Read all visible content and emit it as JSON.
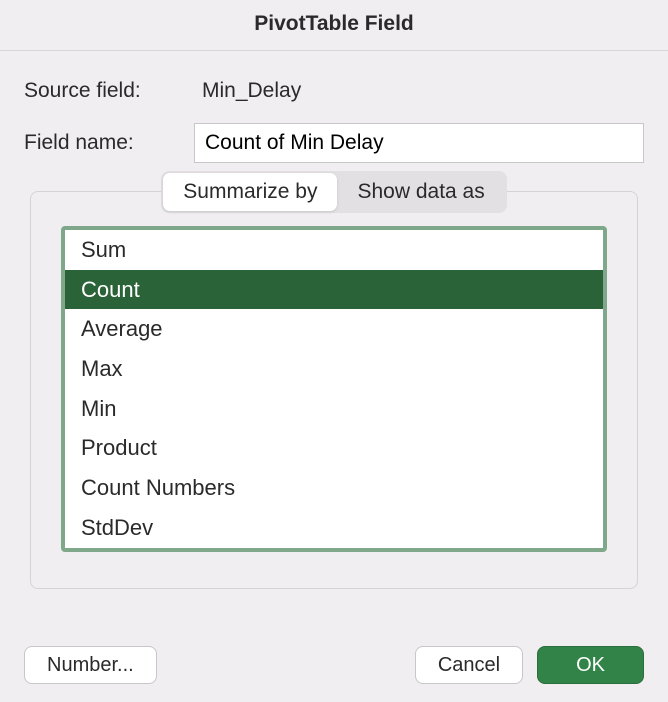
{
  "dialog": {
    "title": "PivotTable Field"
  },
  "fields": {
    "source_label": "Source field:",
    "source_value": "Min_Delay",
    "name_label": "Field name:",
    "name_value": "Count of Min Delay"
  },
  "tabs": {
    "summarize": "Summarize by",
    "showdata": "Show data as"
  },
  "functions": {
    "items": [
      "Sum",
      "Count",
      "Average",
      "Max",
      "Min",
      "Product",
      "Count Numbers",
      "StdDev"
    ],
    "selected_index": 1
  },
  "buttons": {
    "number": "Number...",
    "cancel": "Cancel",
    "ok": "OK"
  }
}
